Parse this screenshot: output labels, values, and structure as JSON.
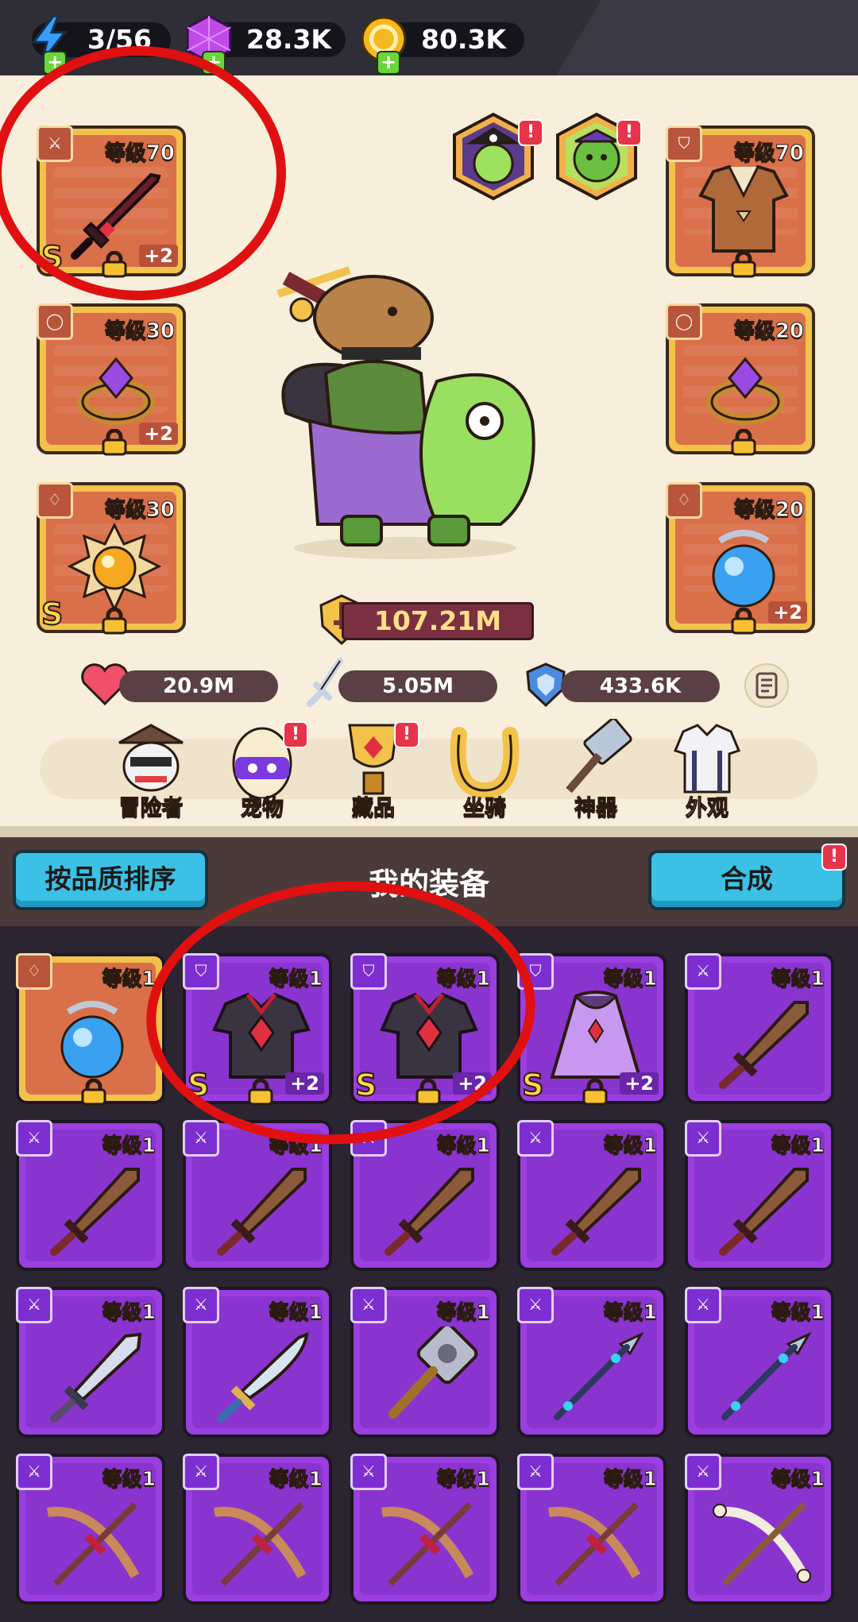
{
  "resources": {
    "energy": "3/56",
    "gems": "28.3K",
    "gold": "80.3K"
  },
  "equipped": {
    "weapon": {
      "level": "等级70",
      "plus": "+2",
      "grade": "S"
    },
    "armor": {
      "level": "等级70"
    },
    "ring_left": {
      "level": "等级30",
      "plus": "+2"
    },
    "ring_right": {
      "level": "等级20"
    },
    "amulet_left": {
      "level": "等级30",
      "grade": "S"
    },
    "amulet_right": {
      "level": "等级20",
      "plus": "+2"
    }
  },
  "combat_power": "107.21M",
  "stats": {
    "hp": "20.9M",
    "attack": "5.05M",
    "defense": "433.6K"
  },
  "nav": [
    {
      "label": "冒险者",
      "badge": ""
    },
    {
      "label": "宠物",
      "badge": "!"
    },
    {
      "label": "藏品",
      "badge": "!"
    },
    {
      "label": "坐骑",
      "badge": ""
    },
    {
      "label": "神器",
      "badge": ""
    },
    {
      "label": "外观",
      "badge": ""
    }
  ],
  "inventory_header": {
    "sort_button": "按品质排序",
    "title": "我的装备",
    "merge_button": "合成",
    "merge_badge": "!"
  },
  "inventory": {
    "row1": [
      {
        "level": "等级1",
        "plus": "",
        "grade": "",
        "kind": "amulet"
      },
      {
        "level": "等级1",
        "plus": "+2",
        "grade": "S",
        "kind": "armor"
      },
      {
        "level": "等级1",
        "plus": "+2",
        "grade": "S",
        "kind": "armor"
      },
      {
        "level": "等级1",
        "plus": "+2",
        "grade": "S",
        "kind": "cloak"
      },
      {
        "level": "等级1",
        "plus": "",
        "grade": "",
        "kind": "sword"
      }
    ],
    "row_level": "等级1"
  },
  "colors": {
    "accent_blue": "#3cc1e6",
    "highlight_red": "#e01010",
    "epic_purple": "#9a3ee0",
    "legendary_orange": "#d9704a"
  }
}
